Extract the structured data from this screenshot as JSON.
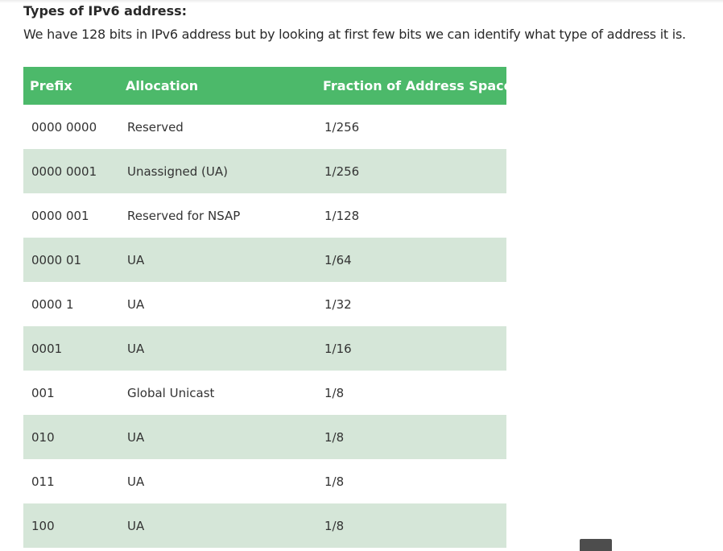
{
  "article": {
    "heading": "Types of IPv6 address:",
    "intro": "We have 128 bits in IPv6 address but by looking at first few bits we can identify what type of address it is."
  },
  "table": {
    "headers": [
      "Prefix",
      "Allocation",
      "Fraction of Address Space"
    ],
    "rows": [
      [
        "0000 0000",
        "Reserved",
        "1/256"
      ],
      [
        "0000 0001",
        "Unassigned (UA)",
        "1/256"
      ],
      [
        "0000 001",
        "Reserved for NSAP",
        "1/128"
      ],
      [
        "0000 01",
        "UA",
        "1/64"
      ],
      [
        "0000 1",
        "UA",
        "1/32"
      ],
      [
        "0001",
        "UA",
        "1/16"
      ],
      [
        "001",
        "Global Unicast",
        "1/8"
      ],
      [
        "010",
        "UA",
        "1/8"
      ],
      [
        "011",
        "UA",
        "1/8"
      ],
      [
        "100",
        "UA",
        "1/8"
      ]
    ]
  },
  "colors": {
    "header_bg": "#4cb96a",
    "striped_row_bg": "#d5e6d8",
    "scroll_button_bg": "#4d4d4d"
  },
  "icons": {
    "scroll_to_top": "scroll-to-top-icon"
  }
}
